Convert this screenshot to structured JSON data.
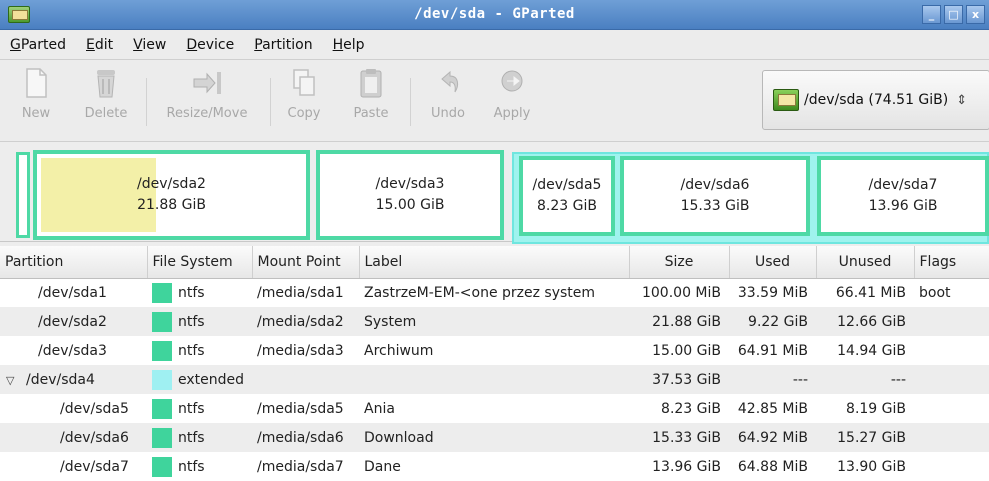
{
  "window": {
    "title": "/dev/sda - GParted",
    "buttons": [
      "_",
      "□",
      "x"
    ]
  },
  "menu": [
    {
      "label": "GParted",
      "mnemonic": "G",
      "rest": "Parted"
    },
    {
      "label": "Edit",
      "mnemonic": "E",
      "rest": "dit"
    },
    {
      "label": "View",
      "mnemonic": "V",
      "rest": "iew"
    },
    {
      "label": "Device",
      "mnemonic": "D",
      "rest": "evice"
    },
    {
      "label": "Partition",
      "mnemonic": "P",
      "rest": "artition"
    },
    {
      "label": "Help",
      "mnemonic": "H",
      "rest": "elp"
    }
  ],
  "toolbar": {
    "new_label": "New",
    "delete_label": "Delete",
    "resize_label": "Resize/Move",
    "copy_label": "Copy",
    "paste_label": "Paste",
    "undo_label": "Undo",
    "apply_label": "Apply",
    "device_selector": "/dev/sda  (74.51 GiB)",
    "device_arrow": "⇕"
  },
  "visual": {
    "partitions": [
      {
        "name": "/dev/sda2",
        "size": "21.88 GiB"
      },
      {
        "name": "/dev/sda3",
        "size": "15.00 GiB"
      },
      {
        "name": "/dev/sda5",
        "size": "8.23 GiB"
      },
      {
        "name": "/dev/sda6",
        "size": "15.33 GiB"
      },
      {
        "name": "/dev/sda7",
        "size": "13.96 GiB"
      }
    ]
  },
  "table": {
    "headers": {
      "partition": "Partition",
      "filesystem": "File System",
      "mount": "Mount Point",
      "label": "Label",
      "size": "Size",
      "used": "Used",
      "unused": "Unused",
      "flags": "Flags"
    },
    "rows": [
      {
        "partition": "/dev/sda1",
        "fs": "ntfs",
        "fs_color": "#3fd49c",
        "mount": "/media/sda1",
        "label": "ZastrzeM-EM-<one przez system",
        "size": "100.00 MiB",
        "used": "33.59 MiB",
        "unused": "66.41 MiB",
        "flags": "boot"
      },
      {
        "partition": "/dev/sda2",
        "fs": "ntfs",
        "fs_color": "#3fd49c",
        "mount": "/media/sda2",
        "label": "System",
        "size": "21.88 GiB",
        "used": "9.22 GiB",
        "unused": "12.66 GiB",
        "flags": ""
      },
      {
        "partition": "/dev/sda3",
        "fs": "ntfs",
        "fs_color": "#3fd49c",
        "mount": "/media/sda3",
        "label": "Archiwum",
        "size": "15.00 GiB",
        "used": "64.91 MiB",
        "unused": "14.94 GiB",
        "flags": ""
      },
      {
        "partition": "/dev/sda4",
        "expander": "▽",
        "fs": "extended",
        "fs_color": "#9ff0f2",
        "mount": "",
        "label": "",
        "size": "37.53 GiB",
        "used": "---",
        "unused": "---",
        "flags": ""
      },
      {
        "partition": "/dev/sda5",
        "fs": "ntfs",
        "fs_color": "#3fd49c",
        "mount": "/media/sda5",
        "label": "Ania",
        "size": "8.23 GiB",
        "used": "42.85 MiB",
        "unused": "8.19 GiB",
        "flags": ""
      },
      {
        "partition": "/dev/sda6",
        "fs": "ntfs",
        "fs_color": "#3fd49c",
        "mount": "/media/sda6",
        "label": "Download",
        "size": "15.33 GiB",
        "used": "64.92 MiB",
        "unused": "15.27 GiB",
        "flags": ""
      },
      {
        "partition": "/dev/sda7",
        "fs": "ntfs",
        "fs_color": "#3fd49c",
        "mount": "/media/sda7",
        "label": "Dane",
        "size": "13.96 GiB",
        "used": "64.88 MiB",
        "unused": "13.90 GiB",
        "flags": ""
      }
    ]
  },
  "colors": {
    "partition_border": "#4ed9a5",
    "extended_bg": "#9ff3ee",
    "used_fill": "#f3f0a8",
    "titlebar": "#4a7fc1"
  }
}
